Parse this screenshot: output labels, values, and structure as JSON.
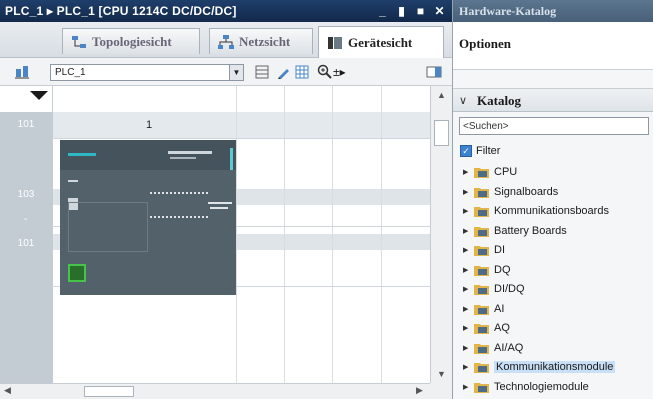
{
  "window": {
    "title": "PLC_1 ▸ PLC_1 [CPU 1214C DC/DC/DC]",
    "buttons": [
      "minimize",
      "float",
      "maximize",
      "close"
    ]
  },
  "tabs": [
    {
      "label": "Topologiesicht",
      "icon": "topology-icon",
      "active": false
    },
    {
      "label": "Netzsicht",
      "icon": "network-icon",
      "active": false
    },
    {
      "label": "Gerätesicht",
      "icon": "device-icon",
      "active": true
    }
  ],
  "toolbar": {
    "device_select_value": "PLC_1"
  },
  "canvas": {
    "slot_header": "1",
    "rack_row_top": "101",
    "rack_row_a": "103",
    "rack_row_b": "101"
  },
  "catalog": {
    "title": "Hardware-Katalog",
    "options_label": "Optionen",
    "catalog_label": "Katalog",
    "search_placeholder": "<Suchen>",
    "filter_label": "Filter",
    "filter_checked": true,
    "items": [
      {
        "label": "CPU"
      },
      {
        "label": "Signalboards"
      },
      {
        "label": "Kommunikationsboards"
      },
      {
        "label": "Battery Boards"
      },
      {
        "label": "DI"
      },
      {
        "label": "DQ"
      },
      {
        "label": "DI/DQ"
      },
      {
        "label": "AI"
      },
      {
        "label": "AQ"
      },
      {
        "label": "AI/AQ"
      },
      {
        "label": "Kommunikationsmodule",
        "highlighted": true
      },
      {
        "label": "Technologiemodule"
      }
    ]
  },
  "colors": {
    "title_bar": "#1f3f6b",
    "catalog_title_bar": "#5c7590",
    "selection": "#c8dff5",
    "plc_body": "#53626a",
    "folder": "#e2b54b"
  }
}
